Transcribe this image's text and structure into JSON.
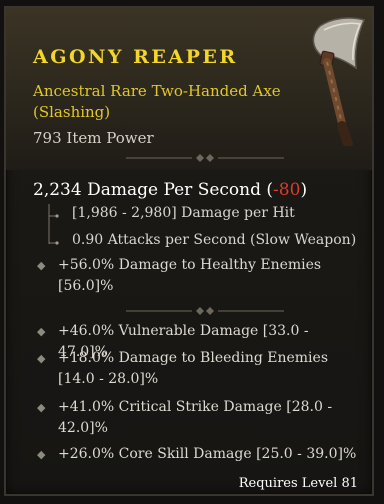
{
  "item": {
    "name": "AGONY REAPER",
    "type_line": "Ancestral Rare Two-Handed Axe (Slashing)",
    "item_power": "793 Item Power"
  },
  "dps": {
    "text": "2,234 Damage Per Second",
    "delta": "-80",
    "open_paren": "(",
    "close_paren": ")"
  },
  "weapon_stats": [
    "[1,986 - 2,980] Damage per Hit",
    "0.90 Attacks per Second (Slow Weapon)"
  ],
  "implicit_affix": "+56.0% Damage to Healthy Enemies [56.0]%",
  "affixes": [
    "+46.0% Vulnerable Damage [33.0 - 47.0]%",
    "+18.0% Damage to Bleeding Enemies [14.0 - 28.0]%",
    "+41.0% Critical Strike Damage [28.0 - 42.0]%",
    "+26.0% Core Skill Damage [25.0 - 39.0]%"
  ],
  "requirement": "Requires Level 81",
  "colors": {
    "rare_title": "#f2d72a",
    "negative_delta": "#e03a2a",
    "panel_bg": "#1b1915"
  },
  "icons": [
    "two-handed-axe-icon",
    "divider-ornament-icon",
    "affix-bullet-icon"
  ]
}
